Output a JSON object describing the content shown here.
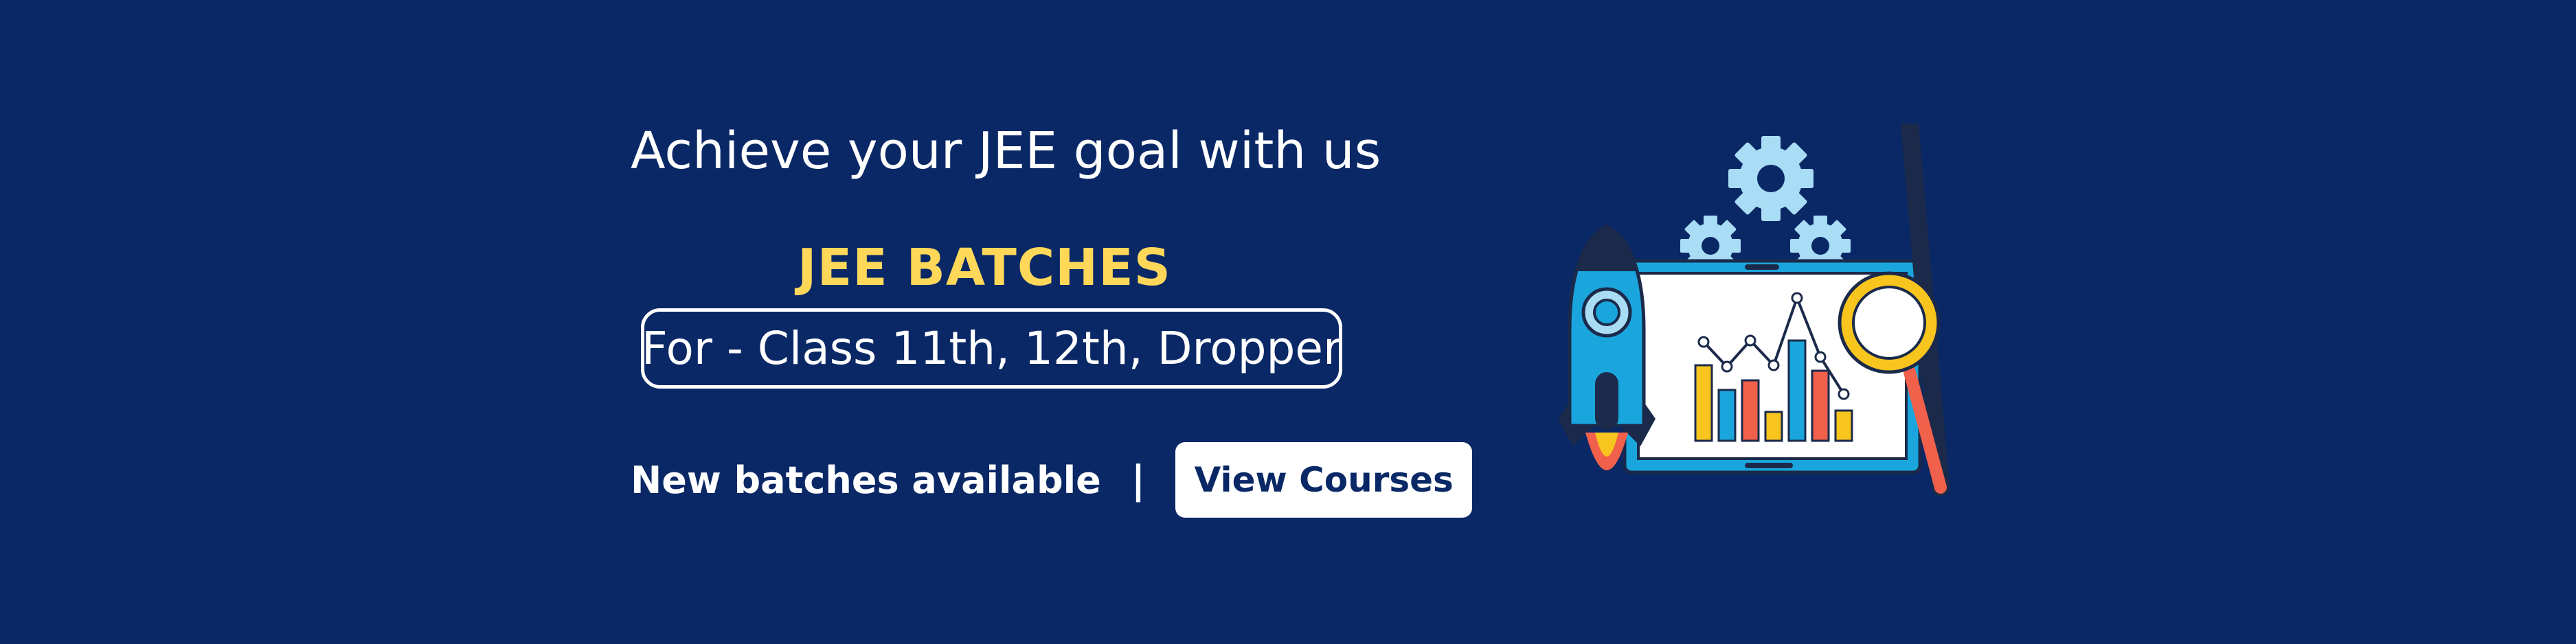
{
  "banner": {
    "headline": "Achieve your JEE goal with us",
    "batch_title": "JEE BATCHES",
    "class_info": "For - Class 11th, 12th, Dropper",
    "cta_text": "New batches available",
    "separator": "|",
    "button_label": "View Courses"
  },
  "colors": {
    "background": "#0a2866",
    "accent_yellow": "#ffd85a",
    "white": "#ffffff",
    "light_blue": "#a9dcf5",
    "cyan": "#1aa6dd",
    "bar_yellow": "#f7c51e",
    "bar_red": "#f1604a"
  },
  "icons": [
    "gear-icon",
    "rocket-icon",
    "laptop-icon",
    "bar-chart-icon",
    "magnifier-icon"
  ]
}
